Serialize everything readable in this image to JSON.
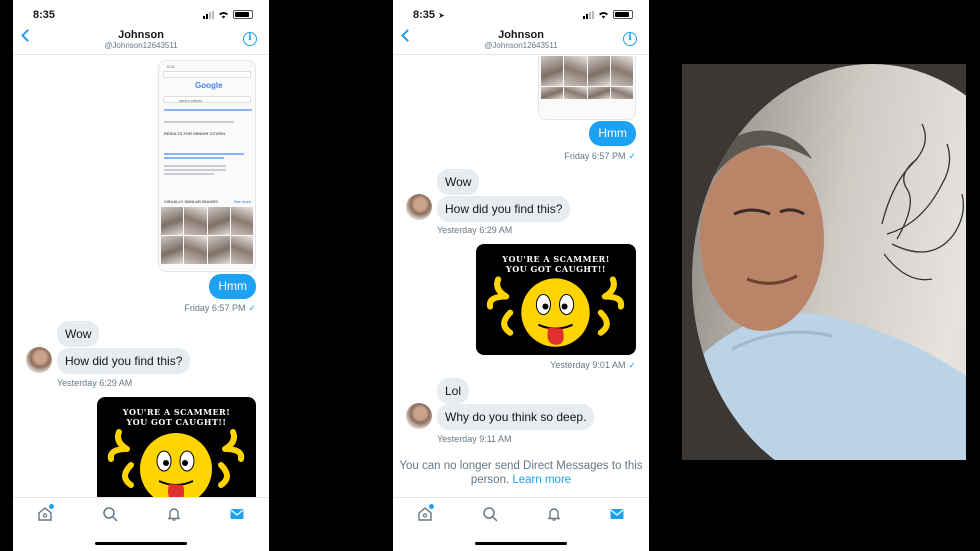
{
  "phone1": {
    "time": "8:35",
    "name": "Johnson",
    "handle": "@Johnson12643511",
    "screenshot": {
      "time": "5:31",
      "logo": "Google",
      "query": "senior citizen",
      "results_header": "RESULTS FOR SENIOR CITIZEN",
      "similar_header": "VISUALLY SIMILAR IMAGES",
      "see_more": "See more"
    },
    "messages": {
      "hmm": "Hmm",
      "hmm_time": "Friday 6:57 PM",
      "wow": "Wow",
      "how": "How did you find this?",
      "how_time": "Yesterday 6:29 AM",
      "meme_line1": "YOU'RE A SCAMMER!",
      "meme_line2": "YOU GOT CAUGHT!!"
    }
  },
  "phone2": {
    "time": "8:35",
    "name": "Johnson",
    "handle": "@Johnson12643511",
    "messages": {
      "hmm": "Hmm",
      "hmm_time": "Friday 6:57 PM",
      "wow": "Wow",
      "how": "How did you find this?",
      "how_time": "Yesterday 6:29 AM",
      "meme_line1": "YOU'RE A SCAMMER!",
      "meme_line2": "YOU GOT CAUGHT!!",
      "meme_time": "Yesterday 9:01 AM",
      "lol": "Lol",
      "why": "Why do you think so deep.",
      "why_time": "Yesterday 9:11 AM"
    },
    "notice": "You can no longer send Direct Messages to this person.",
    "learn_more": "Learn more"
  },
  "icons": [
    "back-icon",
    "info-icon",
    "home-icon",
    "search-icon",
    "bell-icon",
    "mail-icon",
    "check-icon"
  ],
  "colors": {
    "accent": "#1da1f2",
    "bubble_in": "#e6ecf0",
    "meta": "#657786"
  }
}
